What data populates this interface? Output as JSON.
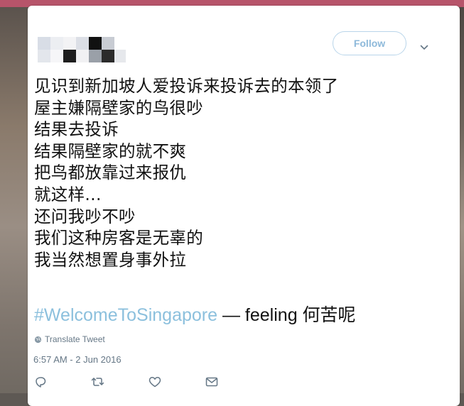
{
  "tweet": {
    "follow_label": "Follow",
    "text_lines": [
      "见识到新加坡人爱投诉来投诉去的本领了",
      "屋主嫌隔壁家的鸟很吵",
      "结果去投诉",
      "结果隔壁家的就不爽",
      "把鸟都放靠过来报仇",
      "就这样...",
      "还问我吵不吵",
      "我们这种房客是无辜的",
      "我当然想置身事外拉"
    ],
    "hashtag": "#WelcomeToSingapore",
    "feeling_text": " — feeling 何苦呢",
    "translate_label": "Translate Tweet",
    "timestamp": "6:57 AM - 2 Jun 2016"
  },
  "icons": {
    "reply": "reply-icon",
    "retweet": "retweet-icon",
    "like": "heart-icon",
    "dm": "envelope-icon",
    "more": "chevron-down-icon",
    "translate": "globe-icon"
  },
  "colors": {
    "follow_border": "#b9d5ea",
    "follow_text": "#8db9da",
    "hashtag": "#8cc0dd",
    "meta_text": "#657786"
  }
}
